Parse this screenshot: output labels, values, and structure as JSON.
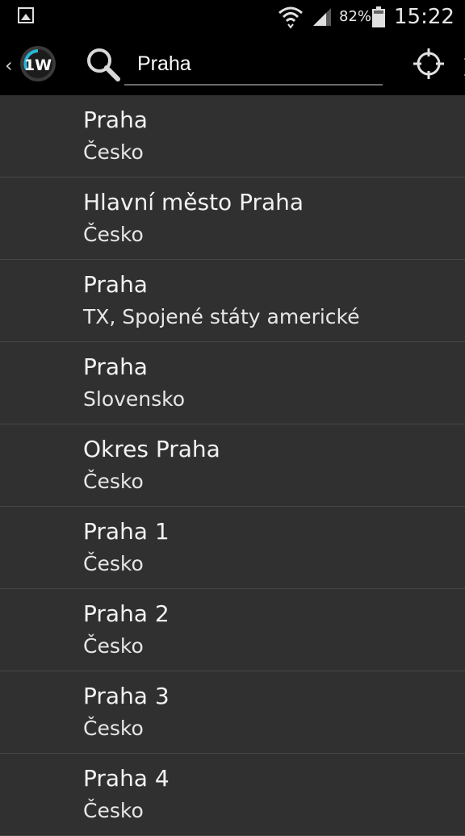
{
  "status_bar": {
    "battery_percent": "82%",
    "time": "15:22",
    "icons": [
      "gallery-icon",
      "wifi-icon",
      "signal-icon",
      "battery-icon"
    ]
  },
  "toolbar": {
    "app_logo_text": "1W",
    "search_value": "Praha",
    "icons": [
      "search-icon",
      "clear-icon",
      "locate-icon"
    ]
  },
  "results": [
    {
      "name": "Praha",
      "country": "Česko"
    },
    {
      "name": "Hlavní město Praha",
      "country": "Česko"
    },
    {
      "name": "Praha",
      "country": "TX, Spojené státy americké"
    },
    {
      "name": "Praha",
      "country": "Slovensko"
    },
    {
      "name": "Okres Praha",
      "country": "Česko"
    },
    {
      "name": "Praha 1",
      "country": "Česko"
    },
    {
      "name": "Praha 2",
      "country": "Česko"
    },
    {
      "name": "Praha 3",
      "country": "Česko"
    },
    {
      "name": "Praha 4",
      "country": "Česko"
    }
  ],
  "colors": {
    "accent": "#29b6d6",
    "background": "#303030",
    "bar": "#000000"
  }
}
